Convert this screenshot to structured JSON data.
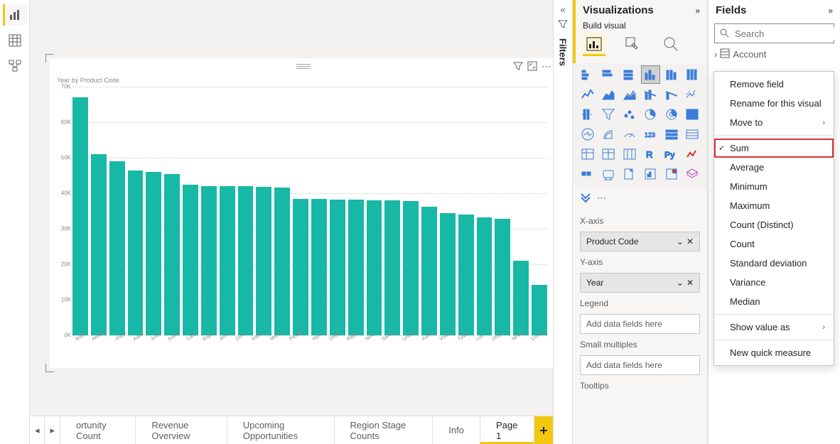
{
  "rail": {
    "report": "Report view",
    "table": "Data view",
    "model": "Model view"
  },
  "filters_label": "Filters",
  "viz_pane": {
    "title": "Visualizations",
    "build_label": "Build visual"
  },
  "wells": {
    "xaxis_label": "X-axis",
    "xaxis_value": "Product Code",
    "yaxis_label": "Y-axis",
    "yaxis_value": "Year",
    "legend_label": "Legend",
    "legend_placeholder": "Add data fields here",
    "small_label": "Small multiples",
    "small_placeholder": "Add data fields here",
    "tooltips_label": "Tooltips"
  },
  "fields_pane": {
    "title": "Fields",
    "search_placeholder": "Search",
    "table1": "Account"
  },
  "context_menu": {
    "remove": "Remove field",
    "rename": "Rename for this visual",
    "move": "Move to",
    "sum": "Sum",
    "average": "Average",
    "minimum": "Minimum",
    "maximum": "Maximum",
    "count_distinct": "Count (Distinct)",
    "count": "Count",
    "stdev": "Standard deviation",
    "variance": "Variance",
    "median": "Median",
    "show_as": "Show value as",
    "new_measure": "New quick measure"
  },
  "tabs": {
    "t1": "ortunity Count",
    "t2": "Revenue Overview",
    "t3": "Upcoming Opportunities",
    "t4": "Region Stage Counts",
    "t5": "Info",
    "t6": "Page 1"
  },
  "chart_title": "Year by Product Code",
  "chart_data": {
    "type": "bar",
    "title": "Year by Product Code",
    "xlabel": "",
    "ylabel": "",
    "ylim": [
      0,
      70000
    ],
    "yticks": [
      "0K",
      "10K",
      "20K",
      "30K",
      "40K",
      "50K",
      "60K",
      "70K"
    ],
    "categories": [
      "Bota",
      "Arianna",
      "Joyya",
      "Aqua",
      "Arion",
      "Azum",
      "Caro",
      "Ergo",
      "Jenn",
      "Zero",
      "Aston",
      "Muros",
      "Peloton",
      "Viper",
      "Orion",
      "Rippo",
      "Nino",
      "Salvus",
      "Linero",
      "Ferra",
      "Votan",
      "Tytan",
      "Lux",
      "Orano",
      "Nirvus",
      "Cryano"
    ],
    "values": [
      67000,
      51000,
      49000,
      46500,
      46000,
      45500,
      42500,
      42000,
      42000,
      42000,
      41800,
      41600,
      38500,
      38500,
      38300,
      38200,
      38100,
      38000,
      37900,
      36200,
      34500,
      34000,
      33200,
      32800,
      21000,
      14200
    ]
  }
}
